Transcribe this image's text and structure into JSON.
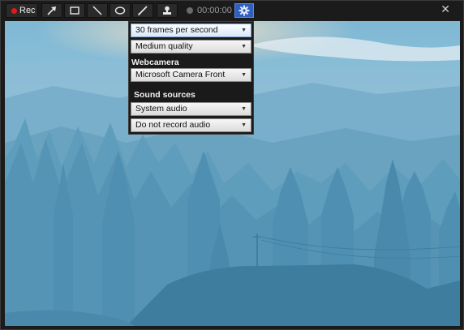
{
  "toolbar": {
    "rec_label": "Rec",
    "timer": "00:00:00",
    "close_glyph": "✕",
    "tools": [
      "arrow-icon",
      "rectangle-icon",
      "line-icon",
      "ellipse-icon",
      "pen-icon",
      "stamp-icon"
    ],
    "settings_icon": "gear-icon"
  },
  "settings": {
    "framerate": "30 frames per second",
    "quality": "Medium quality",
    "webcam_label": "Webcamera",
    "webcam": "Microsoft Camera Front",
    "sound_label": "Sound sources",
    "sound_source": "System audio",
    "audio_record": "Do not record audio"
  },
  "colors": {
    "accent": "#2f5fbf",
    "rec": "#e21a1a",
    "sky": "#5f9fbe"
  }
}
